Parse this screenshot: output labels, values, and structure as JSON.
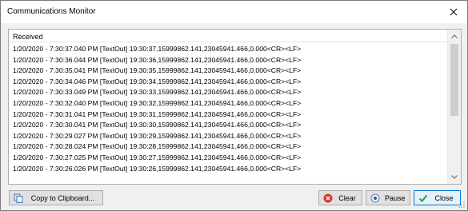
{
  "window": {
    "title": "Communications Monitor"
  },
  "panel": {
    "header": "Received",
    "lines": [
      "1/20/2020 - 7:30:37.040 PM [TextOut] 19:30:37,15999862.141,23045941.466,0.000<CR><LF>",
      "1/20/2020 - 7:30:36.044 PM [TextOut] 19:30:36,15999862.141,23045941.466,0.000<CR><LF>",
      "1/20/2020 - 7:30:35.041 PM [TextOut] 19:30:35,15999862.141,23045941.466,0.000<CR><LF>",
      "1/20/2020 - 7:30:34.046 PM [TextOut] 19:30:34,15999862.141,23045941.466,0.000<CR><LF>",
      "1/20/2020 - 7:30:33.049 PM [TextOut] 19:30:33,15999862.141,23045941.466,0.000<CR><LF>",
      "1/20/2020 - 7:30:32.040 PM [TextOut] 19:30:32,15999862.141,23045941.466,0.000<CR><LF>",
      "1/20/2020 - 7:30:31.041 PM [TextOut] 19:30:31,15999862.141,23045941.466,0.000<CR><LF>",
      "1/20/2020 - 7:30:30.041 PM [TextOut] 19:30:30,15999862.141,23045941.466,0.000<CR><LF>",
      "1/20/2020 - 7:30:29.027 PM [TextOut] 19:30:29,15999862.141,23045941.466,0.000<CR><LF>",
      "1/20/2020 - 7:30:28.024 PM [TextOut] 19:30:28,15999862.141,23045941.466,0.000<CR><LF>",
      "1/20/2020 - 7:30:27.025 PM [TextOut] 19:30:27,15999862.141,23045941.466,0.000<CR><LF>",
      "1/20/2020 - 7:30:26.026 PM [TextOut] 19:30:26,15999862.141,23045941.466,0.000<CR><LF>"
    ]
  },
  "buttons": {
    "copy_label": "Copy to Clipboard...",
    "clear_label": "Clear",
    "pause_label": "Pause",
    "close_label": "Close"
  },
  "colors": {
    "accent": "#0078d7",
    "clear_icon": "#d9342b",
    "check_icon": "#2e9e3e"
  },
  "icons": {
    "copy": "copy-icon",
    "clear": "clear-icon",
    "pause": "pause-icon",
    "close": "check-icon",
    "window_close": "close-icon"
  }
}
